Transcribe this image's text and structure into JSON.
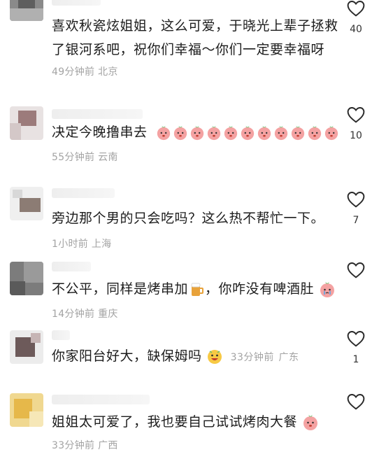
{
  "comments": [
    {
      "text": "喜欢秋瓷炫姐姐，这么可爱，于晓光上辈子拯救了银河系吧，祝你们幸福～你们一定要幸福呀",
      "time": "49分钟前",
      "location": "北京",
      "likes": "40"
    },
    {
      "text": "决定今晚撸串去",
      "time": "55分钟前",
      "location": "云南",
      "likes": "10",
      "emoji": "peach-face-icon",
      "emoji_count": 11
    },
    {
      "text": "旁边那个男的只会吃吗？这么热不帮忙一下。",
      "time": "1小时前",
      "location": "上海",
      "likes": "7"
    },
    {
      "text_a": "不公平，同样是烤串加",
      "text_b": "，你咋没有啤酒肚",
      "time": "14分钟前",
      "location": "重庆",
      "likes": "",
      "emoji_a": "beer-icon",
      "emoji_b": "crying-peach-icon"
    },
    {
      "text": "你家阳台好大，缺保姆吗",
      "time": "33分钟前",
      "location": "广东",
      "likes": "1",
      "emoji": "grinning-face-icon"
    },
    {
      "text": "姐姐太可爱了，我也要自己试试烤肉大餐",
      "time": "33分钟前",
      "location": "广西",
      "likes": "",
      "emoji": "peach-face-icon"
    }
  ],
  "colors": {
    "text": "#1c1c1c",
    "meta": "#a3a3a3",
    "heart_outline": "#2a2a2a",
    "peach": "#f4a2a2"
  }
}
